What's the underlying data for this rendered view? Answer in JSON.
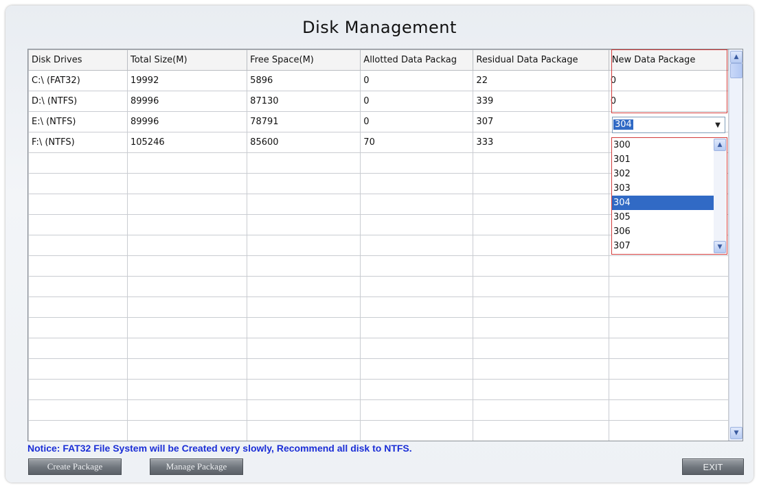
{
  "window": {
    "title": "Disk Management"
  },
  "table": {
    "headers": [
      "Disk Drives",
      "Total Size(M)",
      "Free Space(M)",
      "Allotted Data Packag",
      "Residual Data Package",
      "New Data Package"
    ],
    "rows": [
      [
        "C:\\  (FAT32)",
        "19992",
        "5896",
        "0",
        "22",
        "0"
      ],
      [
        "D:\\  (NTFS)",
        "89996",
        "87130",
        "0",
        "339",
        "0"
      ],
      [
        "E:\\  (NTFS)",
        "89996",
        "78791",
        "0",
        "307",
        ""
      ],
      [
        "F:\\  (NTFS)",
        "105246",
        "85600",
        "70",
        "333",
        ""
      ]
    ],
    "empty_rows": 14
  },
  "combo": {
    "selected": "304",
    "options": [
      "300",
      "301",
      "302",
      "303",
      "304",
      "305",
      "306",
      "307"
    ]
  },
  "notice": "Notice:  FAT32 File System will be Created very slowly, Recommend all disk to NTFS.",
  "buttons": {
    "create": "Create Package",
    "manage": "Manage Package",
    "exit": "EXIT"
  },
  "colors": {
    "notice_text": "#1a2ed6",
    "selection": "#316ac5",
    "highlight_border": "#d23a3a"
  },
  "icons": {
    "combo_arrow": "chevron-down-icon",
    "scroll_up": "scroll-up-icon",
    "scroll_down": "scroll-down-icon"
  }
}
